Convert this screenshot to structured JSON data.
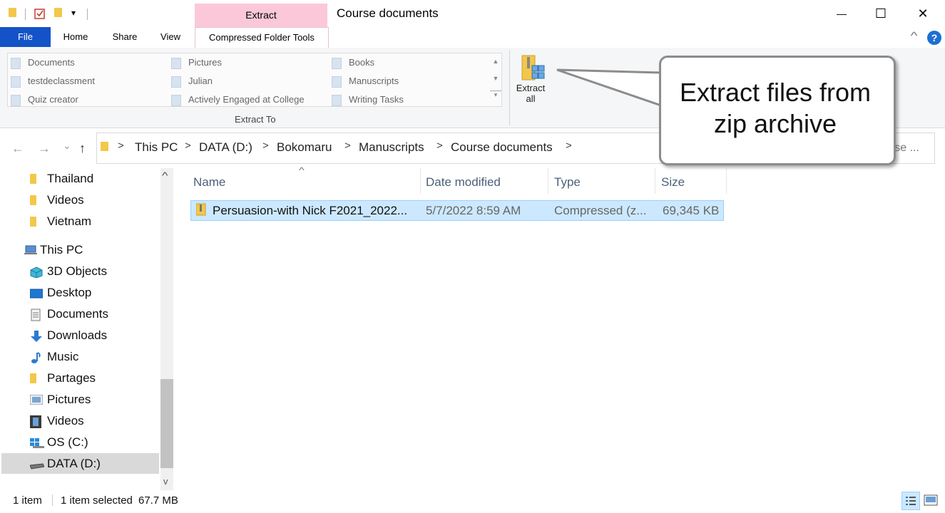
{
  "window": {
    "title": "Course documents",
    "minimize": "—",
    "maximize": "☐",
    "close": "✕",
    "help": "?"
  },
  "quick_access": {
    "dropdown": "▾"
  },
  "ribbon": {
    "contextual_tab_header": "Extract",
    "tabs": [
      "File",
      "Home",
      "Share",
      "View",
      "Compressed Folder Tools"
    ],
    "collapse_chevron": "^",
    "gallery_items": [
      [
        "Documents",
        "Pictures",
        "Books"
      ],
      [
        "testdeclassment",
        "Julian",
        "Manuscripts"
      ],
      [
        "Quiz creator",
        "Actively Engaged at College",
        "Writing Tasks"
      ]
    ],
    "gallery_scroll": {
      "up": "▲",
      "down": "▼",
      "more": "▾"
    },
    "group_label": "Extract To",
    "extract_all": {
      "line1": "Extract",
      "line2": "all"
    }
  },
  "navigation": {
    "back": "←",
    "forward": "→",
    "recent": "⌄",
    "up": "↑"
  },
  "address": {
    "crumbs": [
      "This PC",
      "DATA (D:)",
      "Bokomaru",
      "Manuscripts",
      "Course documents"
    ],
    "separator": ">",
    "search_partial": "urse ..."
  },
  "nav_pane": {
    "items": [
      {
        "label": "Thailand",
        "icon": "folder-icon"
      },
      {
        "label": "Videos",
        "icon": "folder-icon"
      },
      {
        "label": "Vietnam",
        "icon": "folder-icon"
      },
      {
        "label": "This PC",
        "icon": "this-pc-icon"
      },
      {
        "label": "3D Objects",
        "icon": "3d-objects-icon"
      },
      {
        "label": "Desktop",
        "icon": "desktop-icon"
      },
      {
        "label": "Documents",
        "icon": "documents-icon"
      },
      {
        "label": "Downloads",
        "icon": "downloads-icon"
      },
      {
        "label": "Music",
        "icon": "music-icon"
      },
      {
        "label": "Partages",
        "icon": "folder-icon"
      },
      {
        "label": "Pictures",
        "icon": "pictures-icon"
      },
      {
        "label": "Videos",
        "icon": "videos-icon"
      },
      {
        "label": "OS (C:)",
        "icon": "os-drive-icon"
      },
      {
        "label": "DATA (D:)",
        "icon": "data-drive-icon"
      }
    ],
    "scroll_up": "^",
    "scroll_down": "v"
  },
  "file_list": {
    "columns": [
      "Name",
      "Date modified",
      "Type",
      "Size"
    ],
    "sort_indicator": "^",
    "rows": [
      {
        "name": "Persuasion-with Nick F2021_2022...",
        "date": "5/7/2022 8:59 AM",
        "type": "Compressed (z...",
        "size": "69,345 KB"
      }
    ]
  },
  "status_bar": {
    "item_count": "1 item",
    "selection": "1 item selected",
    "selection_size": "67.7 MB"
  },
  "callout": {
    "line1": "Extract files from",
    "line2": "zip archive"
  },
  "colors": {
    "file_tab": "#1453c7",
    "contextual_tab": "#fbc8d9",
    "selection": "#cce8ff",
    "folder": "#f3c74a"
  }
}
